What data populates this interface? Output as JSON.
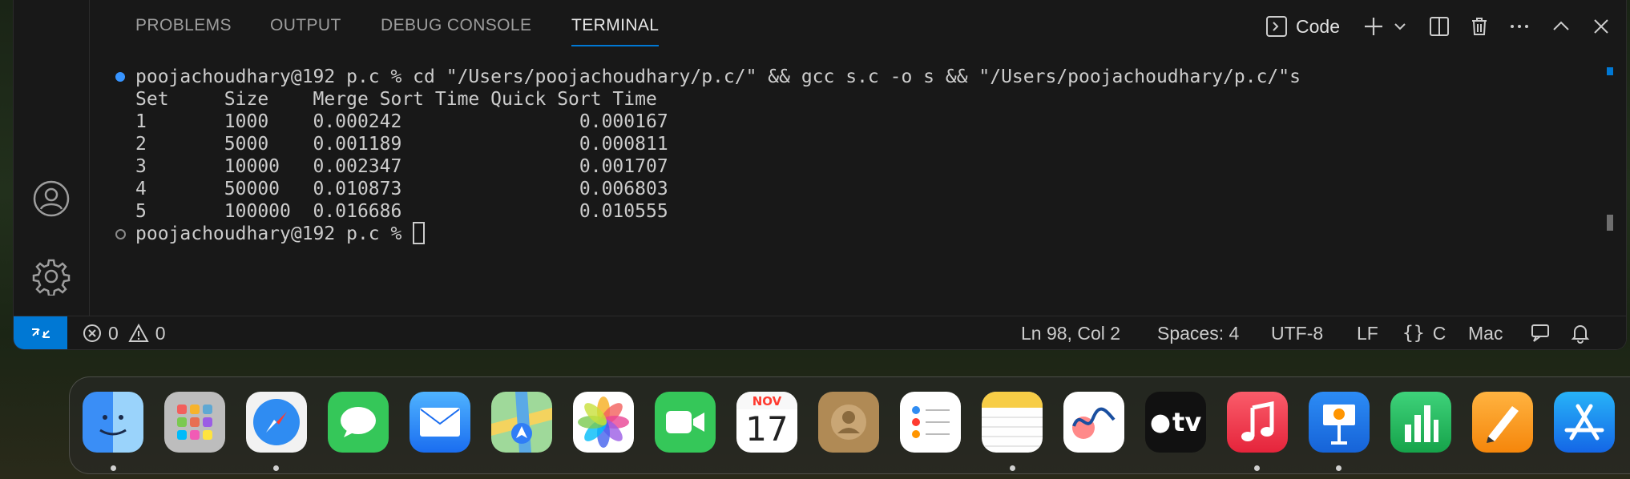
{
  "panel": {
    "tabs": [
      {
        "label": "PROBLEMS"
      },
      {
        "label": "OUTPUT"
      },
      {
        "label": "DEBUG CONSOLE"
      },
      {
        "label": "TERMINAL"
      }
    ],
    "active_tab": "TERMINAL",
    "toolbar": {
      "terminal_name": "Code"
    }
  },
  "terminal": {
    "lines": [
      "poojachoudhary@192 p.c % cd \"/Users/poojachoudhary/p.c/\" && gcc s.c -o s && \"/Users/poojachoudhary/p.c/\"s",
      "Set     Size    Merge Sort Time Quick Sort Time",
      "1       1000    0.000242                0.000167",
      "2       5000    0.001189                0.000811",
      "3       10000   0.002347                0.001707",
      "4       50000   0.010873                0.006803",
      "5       100000  0.016686                0.010555",
      "poojachoudhary@192 p.c % "
    ]
  },
  "statusbar": {
    "errors": "0",
    "warnings": "0",
    "position": "Ln 98, Col 2",
    "spaces": "Spaces: 4",
    "encoding": "UTF-8",
    "eol": "LF",
    "language": "C",
    "platform": "Mac"
  },
  "dock": {
    "calendar_month": "NOV",
    "calendar_day": "17",
    "tv_label": "tv"
  },
  "colors": {
    "accent": "#0078d4",
    "background": "#181818"
  }
}
